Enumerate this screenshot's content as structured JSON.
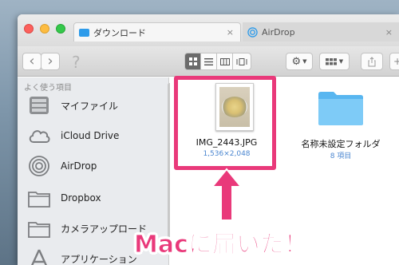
{
  "tabs": [
    {
      "label": "ダウンロード",
      "close": "×"
    },
    {
      "label": "AirDrop",
      "close": "×"
    }
  ],
  "toolbar": {
    "back": "‹",
    "forward": "›",
    "help": "?",
    "add": "+"
  },
  "sidebar": {
    "section": "よく使う項目",
    "items": [
      {
        "label": "マイファイル"
      },
      {
        "label": "iCloud Drive"
      },
      {
        "label": "AirDrop"
      },
      {
        "label": "Dropbox"
      },
      {
        "label": "カメラアップロード"
      },
      {
        "label": "アプリケーション"
      }
    ]
  },
  "files": [
    {
      "name": "IMG_2443.JPG",
      "sub": "1,536×2,048"
    },
    {
      "name": "名称未設定フォルダ",
      "sub": "8 項目"
    }
  ],
  "banner": "Macに届いた！",
  "colors": {
    "accent": "#e9397a",
    "folder": "#58b6f0"
  }
}
